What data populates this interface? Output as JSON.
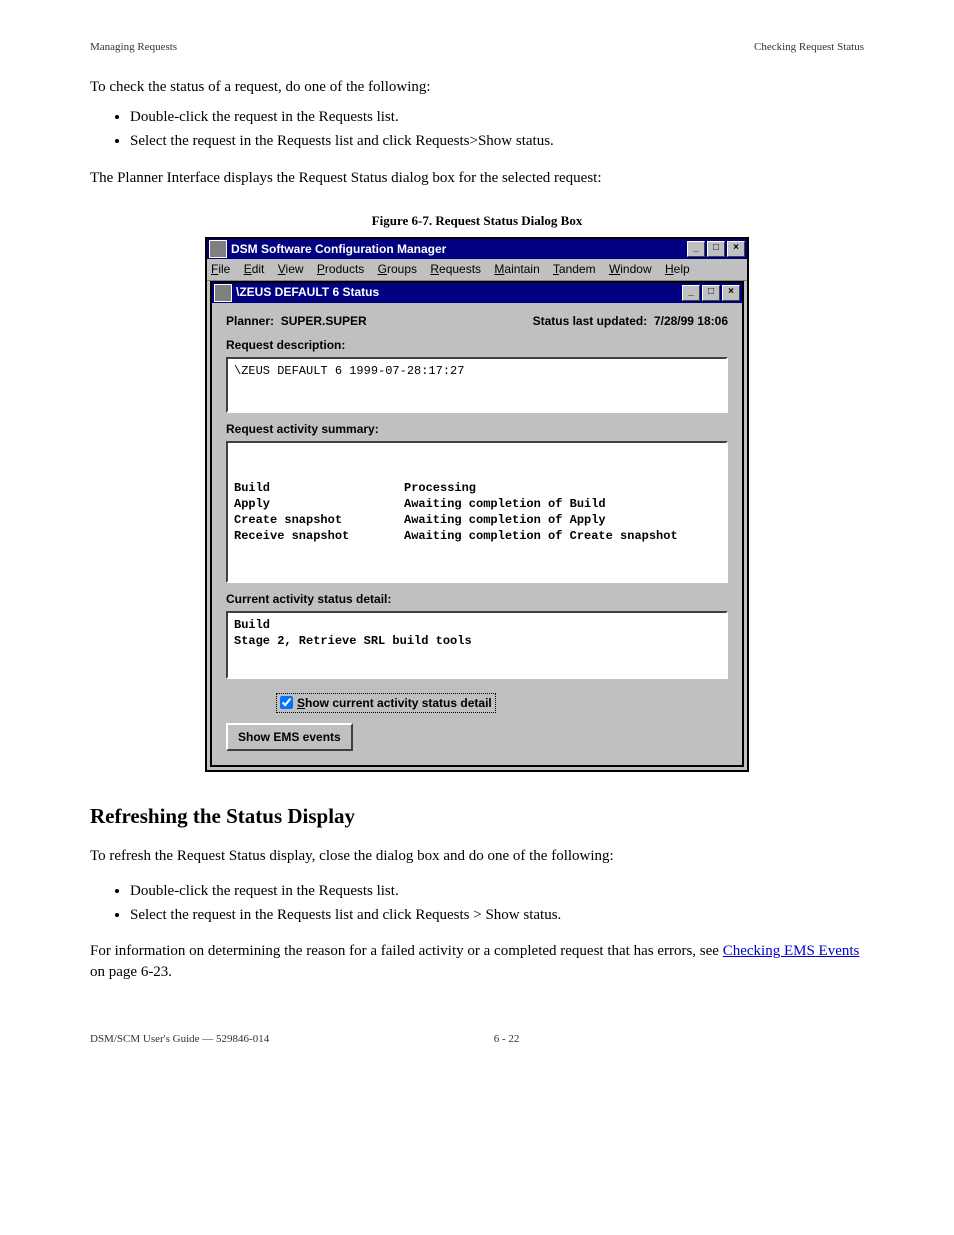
{
  "header": {
    "left": "Managing Requests",
    "right": "Checking Request Status"
  },
  "intro": {
    "lead": "To check the status of a request, do one of the following:",
    "bullets": [
      "Double-click the request in the Requests list.",
      "Select the request in the Requests list and click Requests>Show status."
    ],
    "after": "The Planner Interface displays the Request Status dialog box for the selected request:"
  },
  "fig_caption": "Figure 6-7. Request Status Dialog Box",
  "app": {
    "title": "DSM Software Configuration Manager",
    "menu": [
      "File",
      "Edit",
      "View",
      "Products",
      "Groups",
      "Requests",
      "Maintain",
      "Tandem",
      "Window",
      "Help"
    ],
    "controls": {
      "min": "_",
      "max": "□",
      "close": "×"
    }
  },
  "child": {
    "title": "\\ZEUS DEFAULT 6 Status",
    "controls": {
      "min": "_",
      "max": "□",
      "close": "×"
    },
    "planner_label": "Planner:",
    "planner_value": "SUPER.SUPER",
    "updated_label": "Status last updated:",
    "updated_value": "7/28/99  18:06",
    "req_desc_label": "Request description:",
    "req_desc_value": "\\ZEUS DEFAULT 6 1999-07-28:17:27",
    "summary_label": "Request activity summary:",
    "summary": [
      {
        "a": "Build",
        "s": "Processing"
      },
      {
        "a": "Apply",
        "s": "Awaiting completion of Build"
      },
      {
        "a": "Create snapshot",
        "s": "Awaiting completion of Apply"
      },
      {
        "a": "Receive snapshot",
        "s": "Awaiting completion of Create snapshot"
      }
    ],
    "detail_label": "Current activity status detail:",
    "detail_lines": [
      "Build",
      "Stage 2, Retrieve SRL build tools"
    ],
    "checkbox_label": "Show current activity status detail",
    "ems_button": "Show EMS events"
  },
  "refresh": {
    "heading": "Refreshing the Status Display",
    "lead": "To refresh the Request Status display, close the dialog box and do one of the following:",
    "bullets": [
      "Double-click the request in the Requests list.",
      "Select the request in the Requests list and click Requests > Show status."
    ],
    "after_pre": "For information on determining the reason for a failed activity or a completed request that has errors, see ",
    "after_link": "Checking EMS Events",
    "after_post": " on page 6-23."
  },
  "footer": {
    "left": "DSM/SCM User's Guide — 529846-014",
    "center": "6 - 22"
  }
}
